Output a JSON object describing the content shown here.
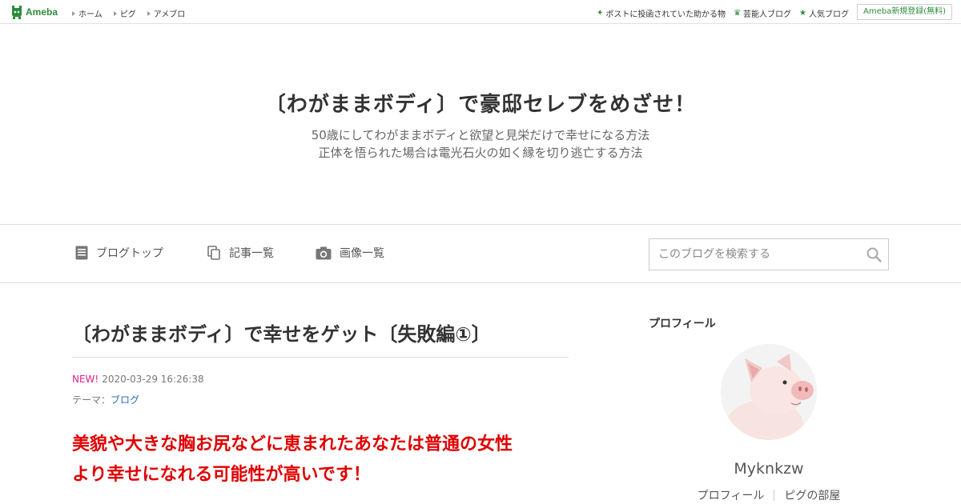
{
  "topbar": {
    "logo_text": "Ameba",
    "nav": [
      "ホーム",
      "ピグ",
      "アメブロ"
    ],
    "right_links": [
      {
        "icon": "sparkle-icon",
        "label": "ポストに投函されていた助かる物"
      },
      {
        "icon": "crown-icon",
        "label": "芸能人ブログ"
      },
      {
        "icon": "star-icon",
        "label": "人気ブログ"
      }
    ],
    "register_label": "Ameba新規登録(無料)"
  },
  "header": {
    "title": "〔わがままボディ〕で豪邸セレブをめざせ！",
    "desc_line1": "50歳にしてわがままボディと欲望と見栄だけで幸せになる方法",
    "desc_line2": "正体を悟られた場合は電光石火の如く縁を切り逃亡する方法"
  },
  "nav": {
    "blog_top": "ブログトップ",
    "articles": "記事一覧",
    "images": "画像一覧",
    "search_placeholder": "このブログを検索する"
  },
  "article": {
    "title": "〔わがままボディ〕で幸せをゲット〔失敗編①〕",
    "new_label": "NEW!",
    "datetime": "2020-03-29 16:26:38",
    "theme_prefix": "テーマ：",
    "theme_link": "ブログ",
    "lead_line1": "美貌や大きな胸お尻などに恵まれたあなたは普通の女性",
    "lead_line2": "より幸せになれる可能性が高いです！"
  },
  "sidebar": {
    "heading": "プロフィール",
    "username": "Myknkzw",
    "link_profile": "プロフィール",
    "link_room": "ピグの部屋"
  },
  "colors": {
    "ameba_green": "#2d8c3c",
    "lead_red": "#e00000",
    "new_pink": "#e0208a",
    "link_blue": "#2b6cb0"
  }
}
